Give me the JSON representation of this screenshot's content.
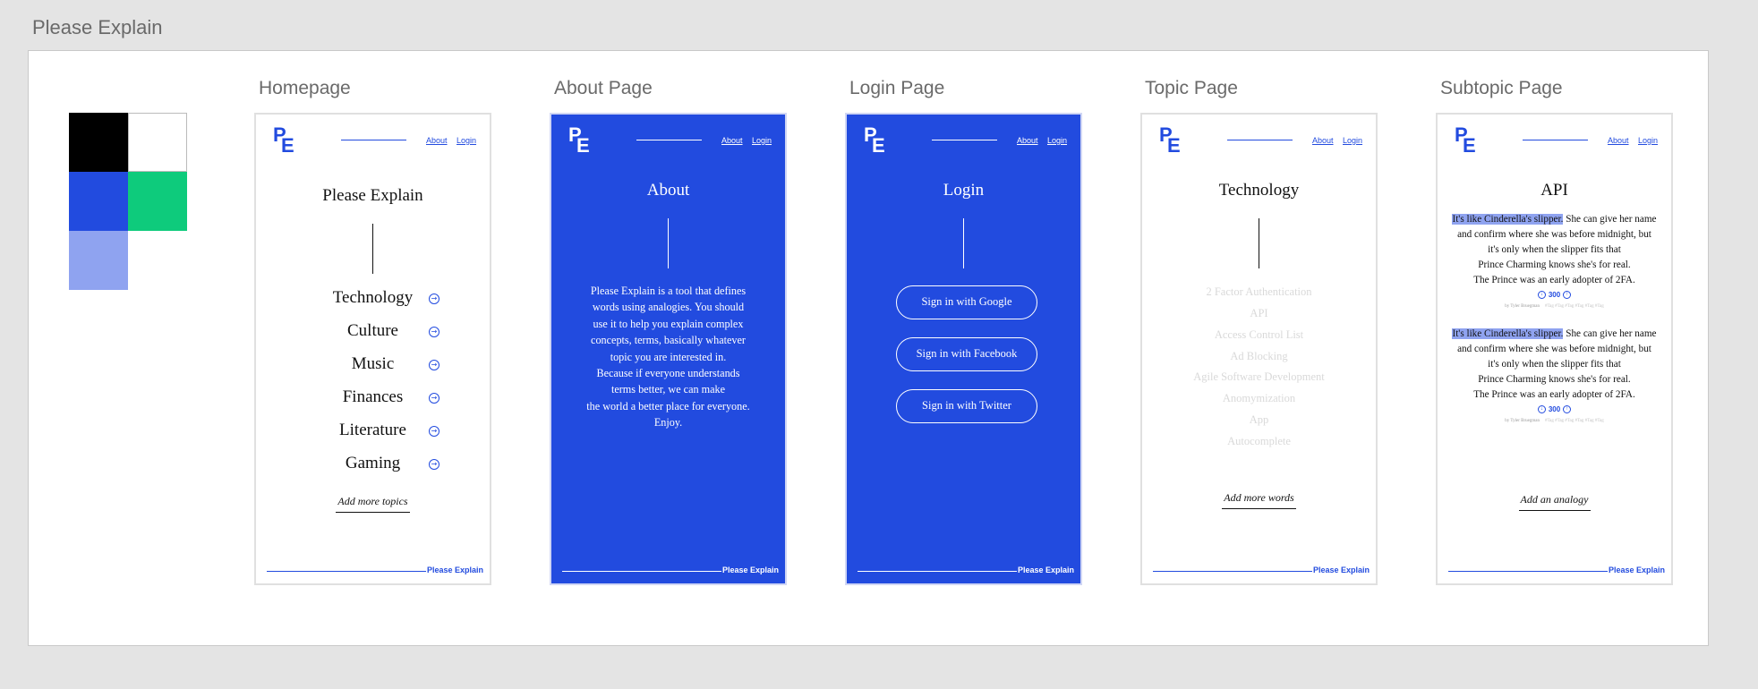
{
  "app": {
    "title": "Please Explain"
  },
  "colors": {
    "black": "#000000",
    "white": "#ffffff",
    "blue": "#224bdf",
    "green": "#0ecb7c",
    "light_blue": "#8fa3f0"
  },
  "brand": {
    "logo_p": "P",
    "logo_e": "E",
    "nav_about": "About",
    "nav_login": "Login",
    "footer": "Please Explain"
  },
  "homepage": {
    "label": "Homepage",
    "title": "Please Explain",
    "topics": [
      "Technology",
      "Culture",
      "Music",
      "Finances",
      "Literature",
      "Gaming"
    ],
    "add_link": "Add more topics",
    "arrow_icon": "→"
  },
  "about": {
    "label": "About Page",
    "title": "About",
    "body": "Please Explain is a tool that defines\nwords using analogies. You should\nuse it to help you explain complex\nconcepts, terms, basically whatever\ntopic you are interested in.\nBecause if everyone understands\nterms better, we can make\nthe world a better place for everyone.\nEnjoy."
  },
  "login": {
    "label": "Login Page",
    "title": "Login",
    "buttons": [
      "Sign in with Google",
      "Sign in with Facebook",
      "Sign in with Twitter"
    ]
  },
  "topic": {
    "label": "Topic Page",
    "title": "Technology",
    "words": [
      "2 Factor Authentication",
      "API",
      "Access Control List",
      "Ad Blocking",
      "Agile Software Development",
      "Anomymization",
      "App",
      "Autocomplete"
    ],
    "add_link": "Add more words"
  },
  "subtopic": {
    "label": "Subtopic Page",
    "title": "API",
    "analogies": [
      {
        "highlight": "It's like Cinderella's slipper.",
        "line1_rest": " She can give her name",
        "line2": "and confirm where she was before midnight, but",
        "line3": "it's only when the slipper fits that",
        "line4": "Prince Charming knows she's for real.",
        "line5": "The Prince was an early adopter of 2FA.",
        "votes": "300",
        "down_icon": "↓",
        "up_icon": "↑",
        "author": "by Tyler Bruegman",
        "tags": "#Tag  #Tag  #Tag  #Tag  #Tag  #Tag"
      },
      {
        "highlight": "It's like Cinderella's slipper.",
        "line1_rest": " She can give her name",
        "line2": "and confirm where she was before midnight, but",
        "line3": "it's only when the slipper fits that",
        "line4": "Prince Charming knows she's for real.",
        "line5": "The Prince was an early adopter of 2FA.",
        "votes": "300",
        "down_icon": "↓",
        "up_icon": "↑",
        "author": "by Tyler Bruegman",
        "tags": "#Tag  #Tag  #Tag  #Tag  #Tag  #Tag"
      }
    ],
    "add_link": "Add an analogy"
  }
}
